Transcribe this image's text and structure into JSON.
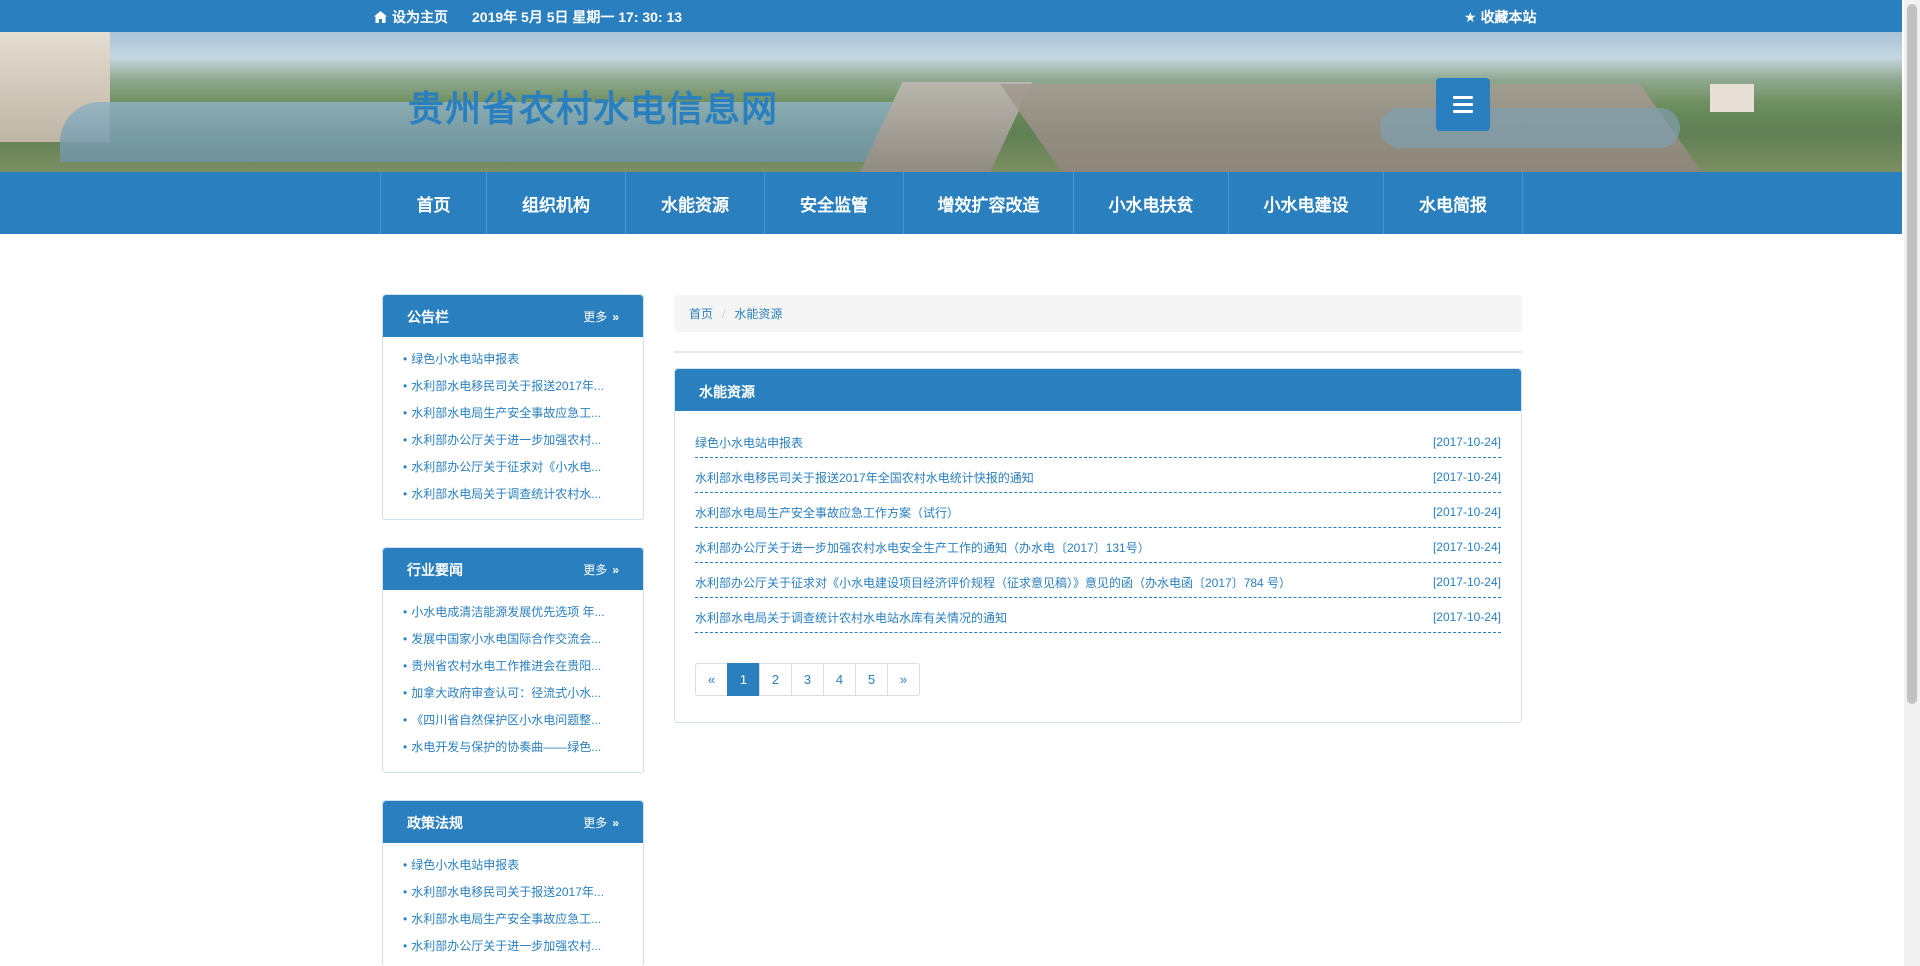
{
  "topbar": {
    "set_home": "设为主页",
    "datetime": "2019年 5月 5日 星期一 17: 30: 13",
    "bookmark": "收藏本站"
  },
  "banner": {
    "site_title": "贵州省农村水电信息网"
  },
  "nav": {
    "items": [
      "首页",
      "组织机构",
      "水能资源",
      "安全监管",
      "增效扩容改造",
      "小水电扶贫",
      "小水电建设",
      "水电简报"
    ]
  },
  "sidebar": {
    "more_label": "更多",
    "panels": [
      {
        "title": "公告栏",
        "items": [
          "绿色小水电站申报表",
          "水利部水电移民司关于报送2017年...",
          "水利部水电局生产安全事故应急工...",
          "水利部办公厅关于进一步加强农村...",
          "水利部办公厅关于征求对《小水电...",
          "水利部水电局关于调查统计农村水..."
        ]
      },
      {
        "title": "行业要闻",
        "items": [
          "小水电成清洁能源发展优先选项 年...",
          "发展中国家小水电国际合作交流会...",
          "贵州省农村水电工作推进会在贵阳...",
          "加拿大政府审查认可：径流式小水...",
          "《四川省自然保护区小水电问题整...",
          "水电开发与保护的协奏曲——绿色..."
        ]
      },
      {
        "title": "政策法规",
        "items": [
          "绿色小水电站申报表",
          "水利部水电移民司关于报送2017年...",
          "水利部水电局生产安全事故应急工...",
          "水利部办公厅关于进一步加强农村..."
        ]
      }
    ]
  },
  "breadcrumb": {
    "home": "首页",
    "separator": "/",
    "current": "水能资源"
  },
  "main": {
    "title": "水能资源",
    "articles": [
      {
        "title": "绿色小水电站申报表",
        "date": "[2017-10-24]"
      },
      {
        "title": "水利部水电移民司关于报送2017年全国农村水电统计快报的通知",
        "date": "[2017-10-24]"
      },
      {
        "title": "水利部水电局生产安全事故应急工作方案（试行）",
        "date": "[2017-10-24]"
      },
      {
        "title": "水利部办公厅关于进一步加强农村水电安全生产工作的通知（办水电〔2017〕131号）",
        "date": "[2017-10-24]"
      },
      {
        "title": "水利部办公厅关于征求对《小水电建设项目经济评价规程（征求意见稿）》意见的函（办水电函〔2017〕784 号）",
        "date": "[2017-10-24]"
      },
      {
        "title": "水利部水电局关于调查统计农村水电站水库有关情况的通知",
        "date": "[2017-10-24]"
      }
    ],
    "pagination": {
      "prev": "«",
      "pages": [
        "1",
        "2",
        "3",
        "4",
        "5"
      ],
      "next": "»",
      "current": "1"
    }
  },
  "colors": {
    "primary": "#2a7fbe",
    "breadcrumb_bg": "#f5f5f5"
  }
}
